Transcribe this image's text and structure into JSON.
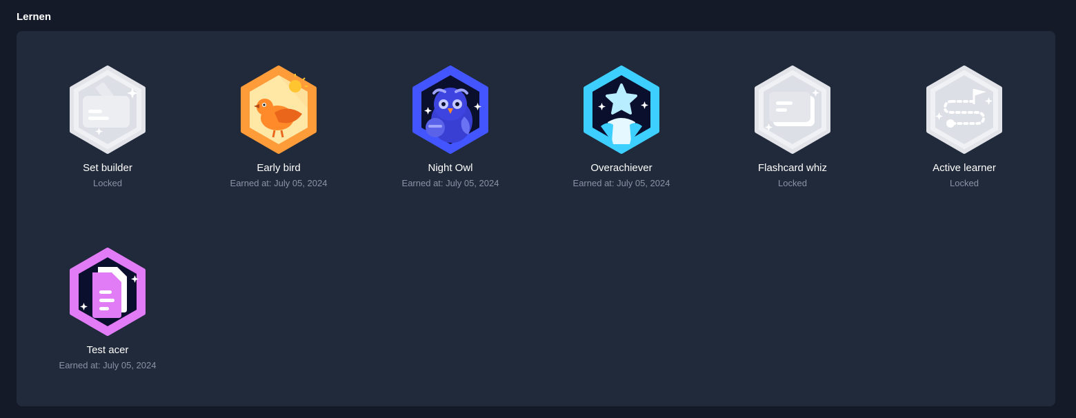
{
  "section": {
    "title": "Lernen"
  },
  "badges": [
    {
      "name": "Set builder",
      "status": "Locked",
      "icon": "set-builder-icon"
    },
    {
      "name": "Early bird",
      "status": "Earned at: July 05, 2024",
      "icon": "early-bird-icon"
    },
    {
      "name": "Night Owl",
      "status": "Earned at: July 05, 2024",
      "icon": "night-owl-icon"
    },
    {
      "name": "Overachiever",
      "status": "Earned at: July 05, 2024",
      "icon": "overachiever-icon"
    },
    {
      "name": "Flashcard whiz",
      "status": "Locked",
      "icon": "flashcard-whiz-icon"
    },
    {
      "name": "Active learner",
      "status": "Locked",
      "icon": "active-learner-icon"
    },
    {
      "name": "Test acer",
      "status": "Earned at: July 05, 2024",
      "icon": "test-acer-icon"
    }
  ],
  "colors": {
    "background": "#141a28",
    "panel": "#212a3a",
    "locked": "#e3e5eb",
    "early_bird": "#ff9c3a",
    "night_owl": "#4255ff",
    "overachiever": "#3ccfff",
    "test_acer": "#e17cf6"
  }
}
